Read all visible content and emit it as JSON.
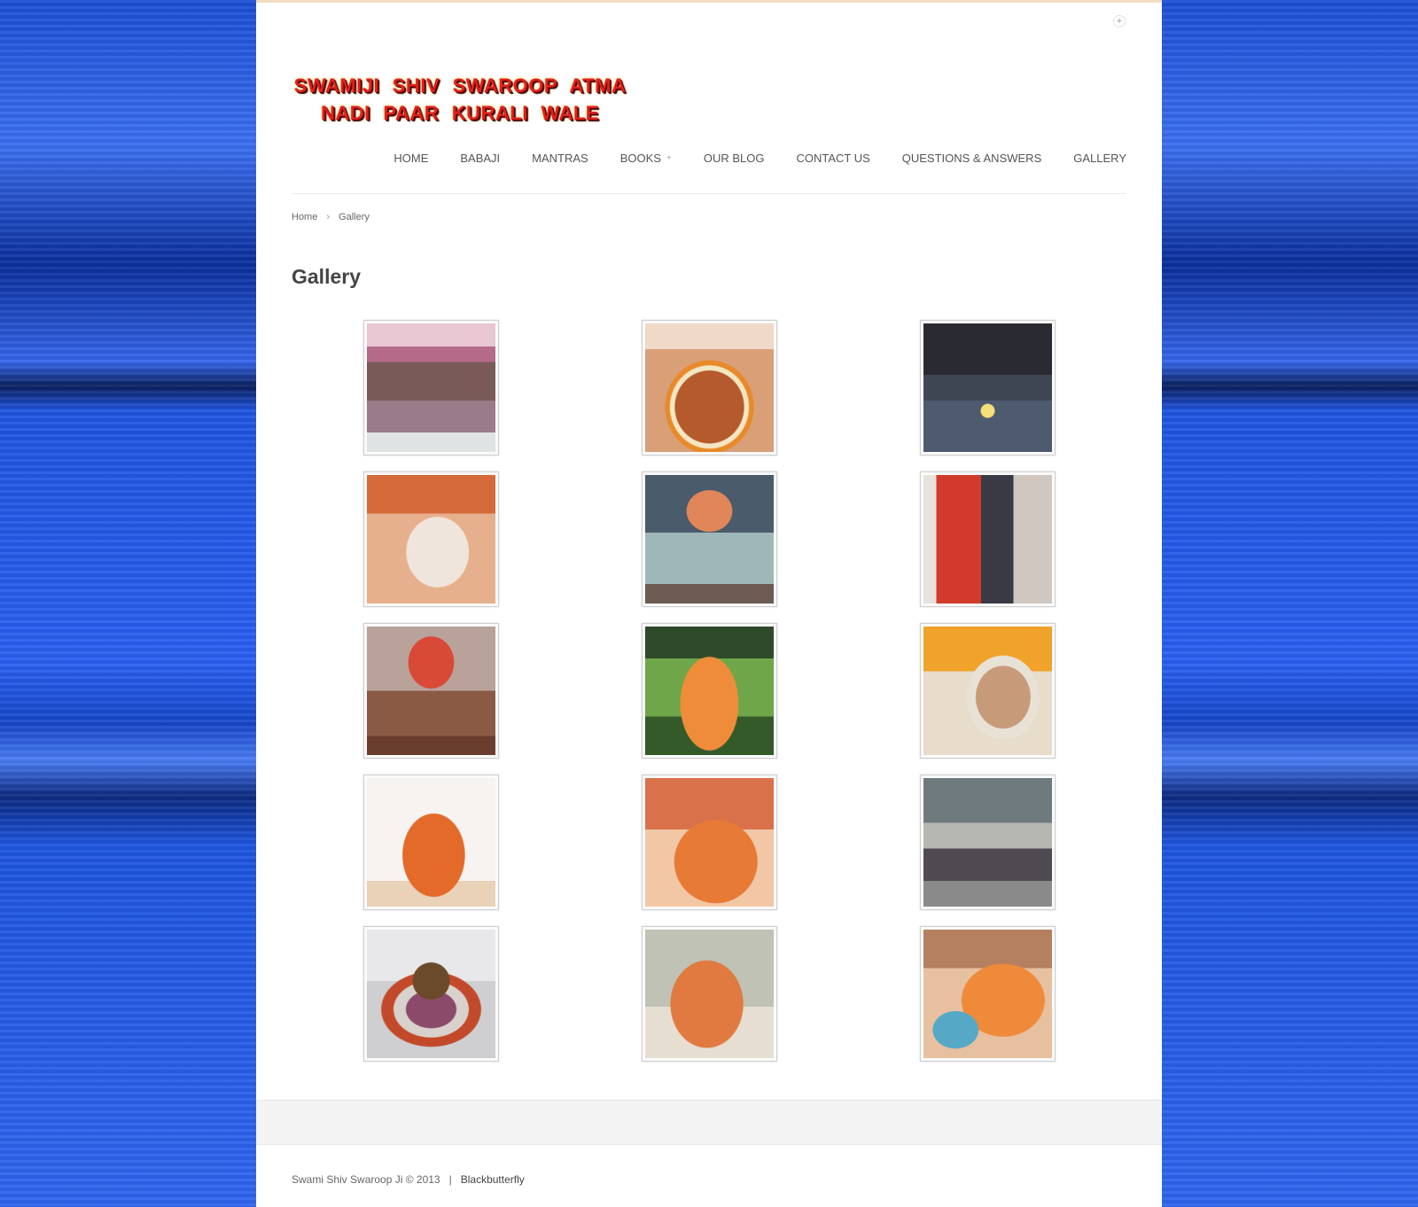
{
  "site": {
    "logo_line1": "SWAMIJI  SHIV  SWAROOP  ATMA",
    "logo_line2": "NADI  PAAR  KURALI  WALE"
  },
  "nav": {
    "items": [
      "HOME",
      "BABAJI",
      "MANTRAS",
      "BOOKS",
      "OUR BLOG",
      "CONTACT US",
      "QUESTIONS & ANSWERS",
      "GALLERY"
    ],
    "books_expand_icon": "plus-icon"
  },
  "breadcrumb": {
    "home": "Home",
    "separator_icon": "chevron-right-icon",
    "current": "Gallery"
  },
  "page": {
    "title": "Gallery"
  },
  "gallery": {
    "images": [
      "gathering-under-tent",
      "flower-garland-offering",
      "temple-with-lamps",
      "swamiji-seated-white",
      "idol-on-pedestal",
      "swamiji-with-devotee",
      "garlanded-idol-shrine",
      "swamiji-seated-outdoors",
      "swamiji-portrait",
      "swamiji-seated-orange",
      "swamiji-reading",
      "crowd-in-hall",
      "flower-rangoli-offering",
      "swamiji-seated-cross-legged",
      "swamiji-blessing-devotees"
    ]
  },
  "footer": {
    "copyright": "Swami Shiv Swaroop Ji © 2013",
    "divider": "|",
    "credit": "Blackbutterfly"
  },
  "colors": {
    "background_blue": "#1e55df",
    "logo_red": "#e2201a",
    "top_border": "#f2dcc0"
  }
}
